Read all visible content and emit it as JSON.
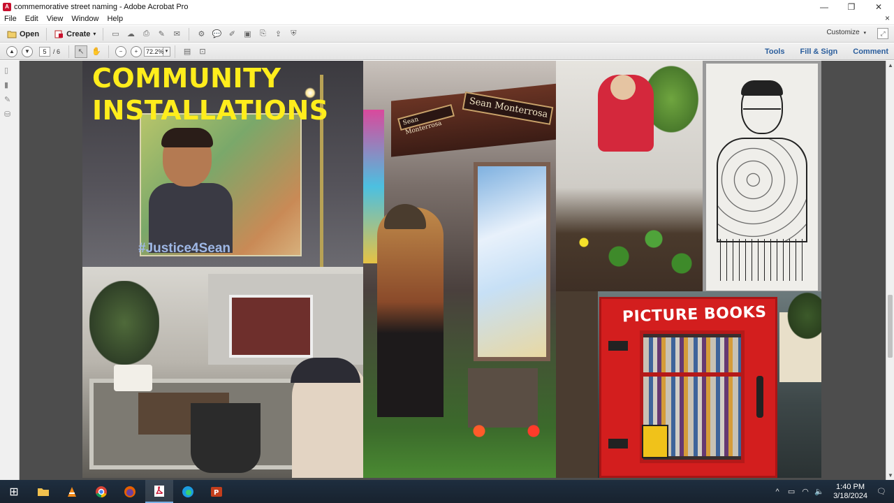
{
  "window": {
    "title": "commemorative street naming  - Adobe Acrobat Pro",
    "controls": {
      "minimize": "—",
      "restore": "❐",
      "close": "✕"
    },
    "doc_close": "×"
  },
  "menu": {
    "items": [
      "File",
      "Edit",
      "View",
      "Window",
      "Help"
    ]
  },
  "toolbar": {
    "open_label": "Open",
    "create_label": "Create",
    "create_caret": "▾",
    "customize_label": "Customize",
    "customize_caret": "▾"
  },
  "nav": {
    "current_page": "5",
    "total_pages": "/  6",
    "zoom": "72.2%",
    "zoom_caret": "▾"
  },
  "right_links": {
    "tools": "Tools",
    "fill_sign": "Fill & Sign",
    "comment": "Comment"
  },
  "slide": {
    "title_line1": "COMMUNITY",
    "title_line2": "INSTALLATIONS",
    "hashtag": "#Justice4Sean",
    "sign_main": "Sean Monterrosa",
    "sign_side": "Sean Monterrosa",
    "box_label": "PICTURE BOOKS"
  },
  "taskbar": {
    "start": "⊞",
    "clock_time": "1:40 PM",
    "clock_date": "3/18/2024",
    "tray_chevron": "^",
    "notification": "🗨"
  }
}
